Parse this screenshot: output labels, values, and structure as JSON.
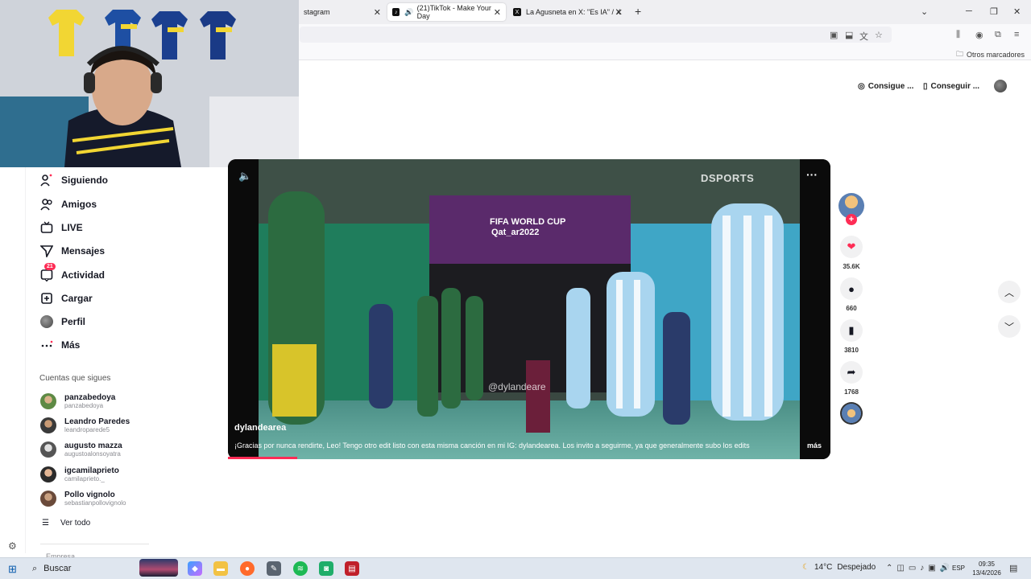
{
  "browser": {
    "tabs": [
      {
        "label": "stagram",
        "active": false
      },
      {
        "label": "(21)TikTok - Make Your Day",
        "active": true
      },
      {
        "label": "La Agusneta en X: \"Es IA\" / X",
        "active": false
      }
    ],
    "new_tab": "+",
    "bookmarks_other": "Otros marcadores"
  },
  "header": {
    "coins_label": "Consigue ...",
    "app_label": "Conseguir ..."
  },
  "sidebar": {
    "items": [
      {
        "label": "Siguiendo",
        "icon": "user-follow-icon"
      },
      {
        "label": "Amigos",
        "icon": "friends-icon"
      },
      {
        "label": "LIVE",
        "icon": "live-icon"
      },
      {
        "label": "Mensajes",
        "icon": "messages-icon"
      },
      {
        "label": "Actividad",
        "icon": "activity-icon",
        "badge": "21"
      },
      {
        "label": "Cargar",
        "icon": "upload-icon"
      },
      {
        "label": "Perfil",
        "icon": "profile-avatar"
      },
      {
        "label": "Más",
        "icon": "more-icon"
      }
    ],
    "following_title": "Cuentas que sigues",
    "accounts": [
      {
        "name": "panzabedoya",
        "username": "panzabedoya"
      },
      {
        "name": "Leandro Paredes",
        "username": "leandroparede5"
      },
      {
        "name": "augusto mazza",
        "username": "augustoalonsoyatra"
      },
      {
        "name": "igcamilaprieto",
        "username": "camilaprieto._"
      },
      {
        "name": "Pollo vignolo",
        "username": "sebastianpollovignolo"
      }
    ],
    "see_all": "Ver todo",
    "company": "Empresa"
  },
  "video": {
    "username": "dylandearea",
    "caption": "¡Gracias por nunca rendirte, Leo! Tengo otro edit listo con esta misma canción en mi IG: dylandearea. Los invito a seguirme, ya que generalmente subo los edits",
    "more": "más",
    "watermark": "DSPORTS",
    "banner_line1": "FIFA WORLD CUP",
    "banner_line2": "Qat_ar2022",
    "handle_overlay": "@dylandeare",
    "progress": 0.115
  },
  "actions": {
    "likes": "35.6K",
    "comments": "660",
    "saves": "3810",
    "shares": "1768"
  },
  "taskbar": {
    "search": "Buscar",
    "weather_temp": "14°C",
    "weather_desc": "Despejado",
    "lang": "ESP",
    "time": "09:35",
    "date": "13/4/2026"
  },
  "colors": {
    "accent": "#fe2c55",
    "text": "#161823"
  }
}
